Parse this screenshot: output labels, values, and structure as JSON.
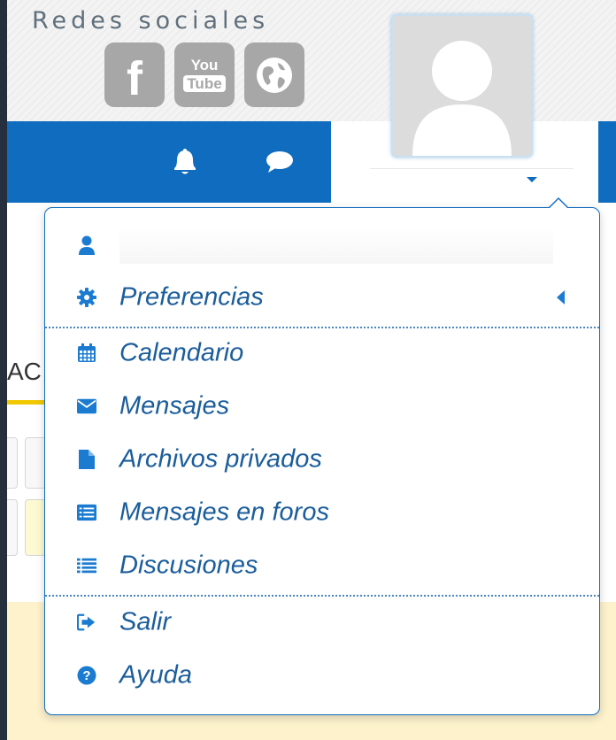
{
  "header": {
    "social_title": "Redes sociales",
    "social_links": [
      {
        "name": "facebook",
        "icon": "facebook-icon",
        "label": "f"
      },
      {
        "name": "youtube",
        "icon": "youtube-icon",
        "label_top": "You",
        "label_bottom": "Tube"
      },
      {
        "name": "website",
        "icon": "globe-icon",
        "label": ""
      }
    ]
  },
  "navbar": {
    "icons": [
      "bell-icon",
      "chat-icon"
    ],
    "color": "#0f6cbf"
  },
  "background": {
    "partial_text": "AC"
  },
  "user_menu": {
    "items": [
      {
        "label": "",
        "icon": "user-icon"
      },
      {
        "label": "Preferencias",
        "icon": "gear-icon",
        "has_submenu": true
      },
      {
        "label": "Calendario",
        "icon": "calendar-icon"
      },
      {
        "label": "Mensajes",
        "icon": "envelope-icon"
      },
      {
        "label": "Archivos privados",
        "icon": "file-icon"
      },
      {
        "label": "Mensajes en foros",
        "icon": "list-alt-icon"
      },
      {
        "label": "Discusiones",
        "icon": "list-icon"
      },
      {
        "label": "Salir",
        "icon": "sign-out-icon"
      },
      {
        "label": "Ayuda",
        "icon": "question-circle-icon"
      }
    ]
  },
  "colors": {
    "accent": "#0f6cbf",
    "link": "#1b5d9b",
    "icon": "#1b7bd1"
  }
}
